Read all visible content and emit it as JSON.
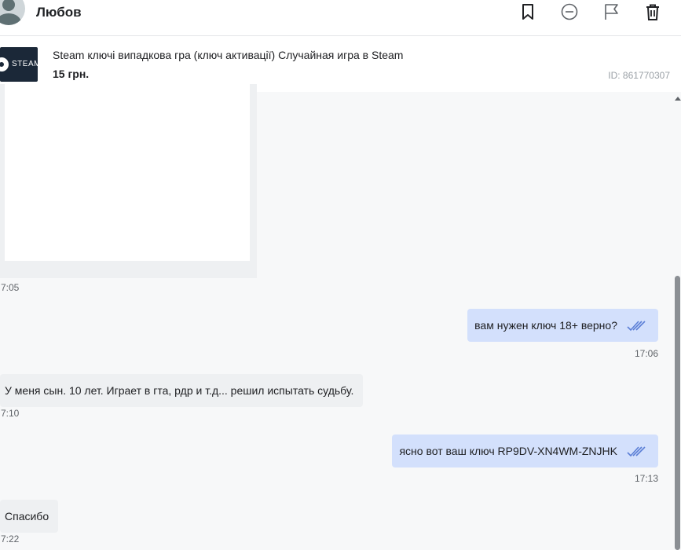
{
  "header": {
    "user_name": "Любов",
    "icons": [
      "bookmark-icon",
      "block-icon",
      "flag-icon",
      "trash-icon"
    ]
  },
  "product": {
    "title": "Steam ключі випадкова гра (ключ активації) Случайная игра в Steam",
    "price": "15 грн.",
    "id": "ID: 861770307",
    "thumb_text": "STEAM"
  },
  "messages": [
    {
      "side": "in",
      "kind": "image",
      "time": "7:05"
    },
    {
      "side": "out",
      "text": "вам нужен ключ 18+ верно?",
      "time": "17:06"
    },
    {
      "side": "in",
      "text": "У меня сын. 10 лет. Играет в гта, рдр и т.д... решил испытать судьбу.",
      "time": "7:10"
    },
    {
      "side": "out",
      "text": "ясно вот ваш ключ RP9DV-XN4WM-ZNJHK",
      "time": "17:13"
    },
    {
      "side": "in",
      "text": "Спасибо",
      "time": "7:22"
    }
  ],
  "colors": {
    "outgoing_bubble": "#d3e0fc",
    "incoming_bubble": "#eef0f2",
    "read_checks": "#5b7fd6"
  }
}
